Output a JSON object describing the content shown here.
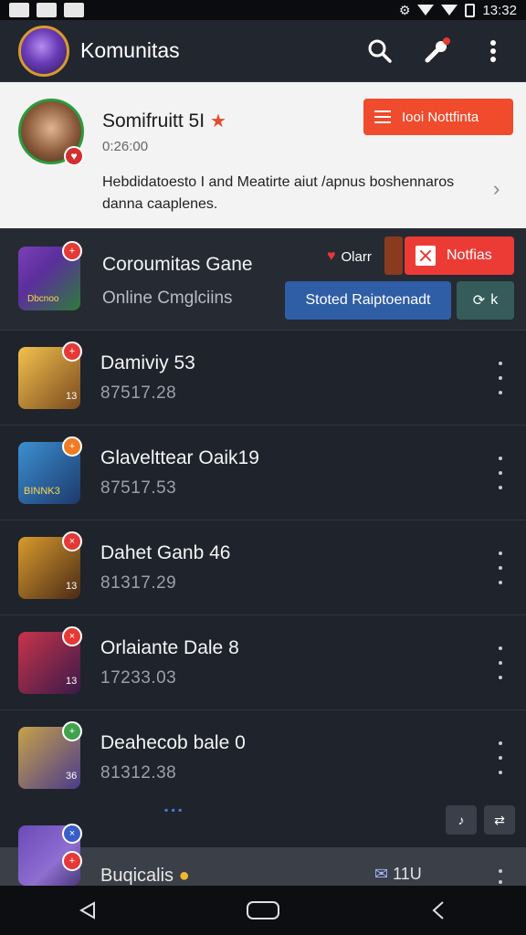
{
  "status_bar": {
    "time": "13:32"
  },
  "app_bar": {
    "title": "Komunitas"
  },
  "featured": {
    "name": "Somifruitt 5I",
    "time": "0:26:00",
    "description": "Hebdidatoesto I and Meatirte aiut /apnus boshennaros danna caaplenes.",
    "notif_button": "Iooi Nottfinta"
  },
  "game_header": {
    "title": "Coroumitas Gane",
    "subtitle": "Online Cmglciins",
    "online_label": "Olarr",
    "notif_button": "Notfias",
    "blue_button": "Stoted Raiptoenadt",
    "teal_button": "k",
    "thumb_corner": "Dbcnoo"
  },
  "rows": [
    {
      "title": "Damiviy 53",
      "subtitle": "87517.28",
      "badge": "+",
      "corner": "13",
      "badge_color": "#e53935",
      "thumb_from": "#f2c14e",
      "thumb_to": "#7a4a1e"
    },
    {
      "title": "Glavelttear Oaik19",
      "subtitle": "87517.53",
      "badge": "+",
      "corner": "BINNK3",
      "badge_color": "#ef7b22",
      "thumb_from": "#3b8fd1",
      "thumb_to": "#1d3a6b"
    },
    {
      "title": "Dahet Ganb 46",
      "subtitle": "81317.29",
      "badge": "×",
      "corner": "13",
      "badge_color": "#e53935",
      "thumb_from": "#d99b2e",
      "thumb_to": "#4a2a16"
    },
    {
      "title": "Orlaiante Dale 8",
      "subtitle": "17233.03",
      "badge": "×",
      "corner": "13",
      "badge_color": "#e53935",
      "thumb_from": "#c9344a",
      "thumb_to": "#3a1a4a"
    },
    {
      "title": "Deahecob bale 0",
      "subtitle": "81312.38",
      "badge": "+",
      "corner": "36",
      "badge_color": "#3fa34d",
      "thumb_from": "#c7a14a",
      "thumb_to": "#4a3b8a"
    }
  ],
  "last_row": {
    "title": "Buqicalis",
    "right": "11U"
  },
  "float_buttons": [
    "♪",
    "⇄"
  ]
}
